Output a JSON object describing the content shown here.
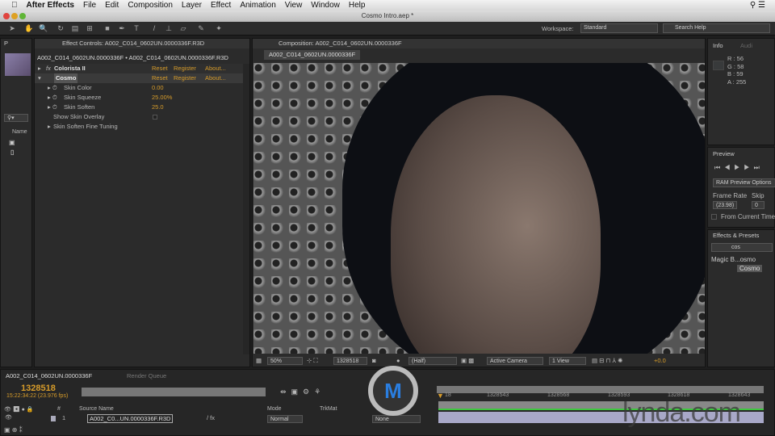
{
  "menubar": {
    "app": "After Effects",
    "items": [
      "File",
      "Edit",
      "Composition",
      "Layer",
      "Effect",
      "Animation",
      "View",
      "Window",
      "Help"
    ]
  },
  "window": {
    "title": "Cosmo Intro.aep *"
  },
  "toolbar": {
    "workspace_label": "Workspace:",
    "workspace_value": "Standard",
    "search_placeholder": "Search Help"
  },
  "project": {
    "tab": "P",
    "name_col": "Name"
  },
  "effect_controls": {
    "tab": "Effect Controls: A002_C014_0602UN.0000336F.R3D",
    "breadcrumb": "A002_C014_0602UN.0000336F • A002_C014_0602UN.0000336F.R3D",
    "effects": [
      {
        "fx": "fx",
        "name": "Colorista II",
        "reset": "Reset",
        "register": "Register",
        "about": "About..."
      },
      {
        "fx": "fx",
        "name": "Cosmo",
        "reset": "Reset",
        "register": "Register",
        "about": "About..."
      }
    ],
    "params": [
      {
        "name": "Skin Color",
        "value": "0.00"
      },
      {
        "name": "Skin Squeeze",
        "value": "25.00%"
      },
      {
        "name": "Skin Soften",
        "value": "25.0"
      },
      {
        "name": "Show Skin Overlay",
        "value": ""
      },
      {
        "name": "Skin Soften Fine Tuning",
        "value": ""
      }
    ]
  },
  "composition": {
    "tab": "Composition: A002_C014_0602UN.0000336F",
    "subtab": "A002_C014_0602UN.0000336F",
    "footer": {
      "zoom": "50%",
      "timecode": "1328518",
      "resolution": "(Half)",
      "camera": "Active Camera",
      "views": "1 View",
      "exposure": "+0.0"
    }
  },
  "info": {
    "tab": "Info",
    "tab2": "Audi",
    "r": "R : 56",
    "g": "G : 58",
    "b": "B : 59",
    "a": "A : 255"
  },
  "preview": {
    "tab": "Preview",
    "ram": "RAM Preview Options",
    "frame_rate_label": "Frame Rate",
    "skip_label": "Skip",
    "frame_rate": "(23.98)",
    "skip": "0",
    "from_current": "From Current Time"
  },
  "effects_presets": {
    "tab": "Effects & Presets",
    "search": "cos",
    "category": "Magic B...osmo",
    "item": "Cosmo"
  },
  "timeline": {
    "tab": "A002_C014_0602UN.0000336F",
    "tab2": "Render Queue",
    "timecode": "1328518",
    "subtime": "15:22:34:22 (23.976 fps)",
    "columns": {
      "source": "Source Name",
      "mode": "Mode",
      "trkmat": "TrkMat",
      "num": "#"
    },
    "layer": {
      "num": "1",
      "name": "A002_C0...UN.0000336F.R3D",
      "mode": "Normal",
      "parent": "None"
    },
    "ruler": [
      "18",
      "1328543",
      "1328568",
      "1328593",
      "1328618",
      "1328643"
    ]
  },
  "watermark": "lynda.com",
  "colors": {
    "accent": "#d79c2a",
    "work_area": "#3ec83e",
    "layer_bar": "#a8a8c8"
  }
}
